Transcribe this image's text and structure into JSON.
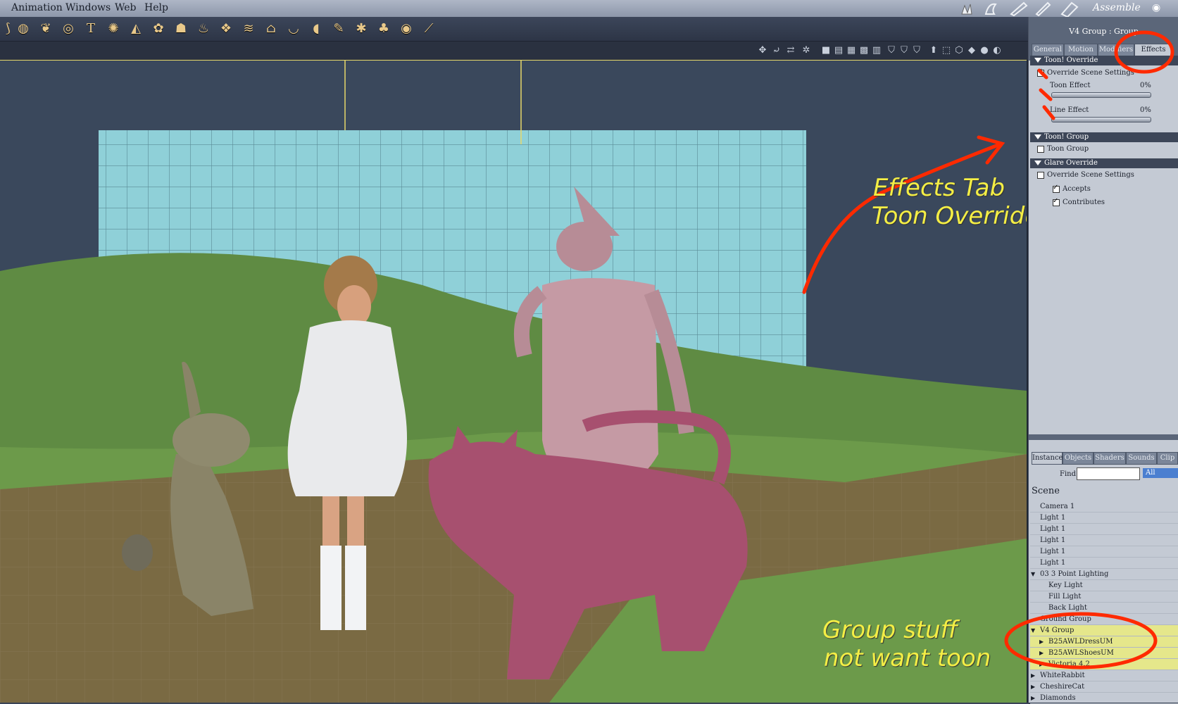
{
  "menu": [
    "Animation",
    "Windows",
    "Web",
    "Help"
  ],
  "room_label": "Assemble",
  "toolbar_icons": [
    "sphere-icon",
    "duck-icon",
    "torus-icon",
    "text-t-icon",
    "gear-icon",
    "terrain-icon",
    "plant-icon",
    "hand-icon",
    "flame-icon",
    "rocks-icon",
    "water-icon",
    "house-icon",
    "bowl-icon",
    "shoe-icon",
    "brush-icon",
    "spider-icon",
    "tree-icon",
    "target-icon",
    "bone-icon"
  ],
  "panel": {
    "title": "V4 Group : Group",
    "tabs": [
      "General",
      "Motion",
      "Modifiers",
      "Effects"
    ],
    "active_tab": "Effects",
    "toon_override": {
      "header": "Toon! Override",
      "override_scene_settings": {
        "label": "Override Scene Settings",
        "checked": true
      },
      "toon_effect": {
        "label": "Toon Effect",
        "value": "0%",
        "fraction": 0
      },
      "line_effect": {
        "label": "Line Effect",
        "value": "0%",
        "fraction": 0
      }
    },
    "toon_group": {
      "header": "Toon! Group",
      "toon_group": {
        "label": "Toon Group",
        "checked": false
      }
    },
    "glare_override": {
      "header": "Glare Override",
      "override_scene_settings": {
        "label": "Override Scene Settings",
        "checked": false
      },
      "accepts": {
        "label": "Accepts",
        "checked": true
      },
      "contributes": {
        "label": "Contributes",
        "checked": true
      }
    }
  },
  "browser": {
    "tabs": [
      "Instances",
      "Objects",
      "Shaders",
      "Sounds",
      "Clip"
    ],
    "find_label": "Find:",
    "find_value": "",
    "filter": "All",
    "scene_label": "Scene",
    "items": [
      {
        "label": "Camera 1",
        "indent": 0,
        "expander": "none",
        "highlight": false
      },
      {
        "label": "Light 1",
        "indent": 0,
        "expander": "none",
        "highlight": false
      },
      {
        "label": "Light 1",
        "indent": 0,
        "expander": "none",
        "highlight": false
      },
      {
        "label": "Light 1",
        "indent": 0,
        "expander": "none",
        "highlight": false
      },
      {
        "label": "Light 1",
        "indent": 0,
        "expander": "none",
        "highlight": false
      },
      {
        "label": "Light 1",
        "indent": 0,
        "expander": "none",
        "highlight": false
      },
      {
        "label": "03 3 Point Lighting",
        "indent": 0,
        "expander": "open",
        "highlight": false
      },
      {
        "label": "Key Light",
        "indent": 1,
        "expander": "none",
        "highlight": false
      },
      {
        "label": "Fill Light",
        "indent": 1,
        "expander": "none",
        "highlight": false
      },
      {
        "label": "Back Light",
        "indent": 1,
        "expander": "none",
        "highlight": false
      },
      {
        "label": "Ground Group",
        "indent": 0,
        "expander": "none",
        "highlight": false
      },
      {
        "label": "V4 Group",
        "indent": 0,
        "expander": "open",
        "highlight": true
      },
      {
        "label": "B25AWLDressUM",
        "indent": 1,
        "expander": "closed",
        "highlight": true
      },
      {
        "label": "B25AWLShoesUM",
        "indent": 1,
        "expander": "closed",
        "highlight": true
      },
      {
        "label": "Victoria 4.2",
        "indent": 1,
        "expander": "closed",
        "highlight": true
      },
      {
        "label": "WhiteRabbit",
        "indent": 0,
        "expander": "closed",
        "highlight": false
      },
      {
        "label": "CheshireCat",
        "indent": 0,
        "expander": "closed",
        "highlight": false
      },
      {
        "label": "Diamonds",
        "indent": 0,
        "expander": "closed",
        "highlight": false
      }
    ]
  },
  "annotations": {
    "effects_line1": "Effects Tab",
    "effects_line2": "Toon Override",
    "group_line1": "Group stuff",
    "group_line2": "not want toon"
  },
  "colors": {
    "annotation_text": "#f4ee45",
    "annotation_markup": "#ff2a00",
    "highlight_row": "#e5e78b"
  }
}
